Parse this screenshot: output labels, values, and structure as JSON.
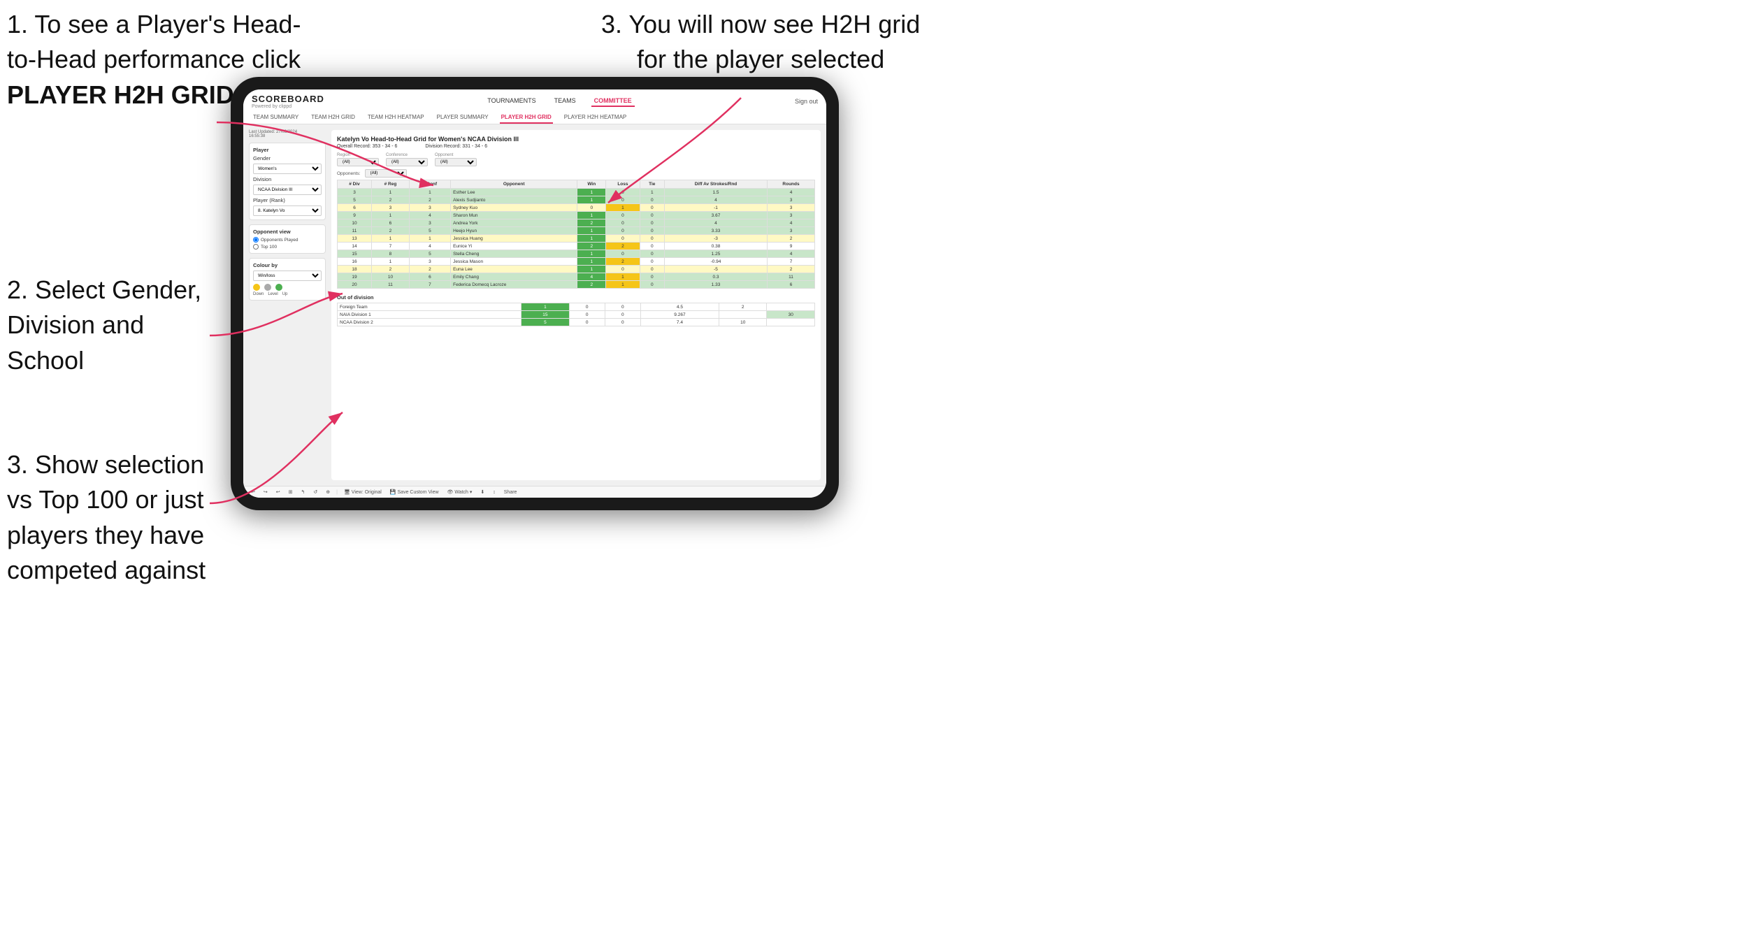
{
  "annotations": {
    "top_left_1": "1. To see a Player's Head-",
    "top_left_2": "to-Head performance click",
    "top_left_bold": "PLAYER H2H GRID",
    "top_right_1": "3. You will now see H2H grid",
    "top_right_2": "for the player selected",
    "left_mid_1": "2. Select Gender,",
    "left_mid_2": "Division and",
    "left_mid_3": "School",
    "left_bot_1": "3. Show selection",
    "left_bot_2": "vs Top 100 or just",
    "left_bot_3": "players they have",
    "left_bot_4": "competed against"
  },
  "nav": {
    "logo": "SCOREBOARD",
    "logo_sub": "Powered by clippd",
    "links": [
      "TOURNAMENTS",
      "TEAMS",
      "COMMITTEE"
    ],
    "active_link": "COMMITTEE",
    "sign_out": "Sign out",
    "sub_links": [
      "TEAM SUMMARY",
      "TEAM H2H GRID",
      "TEAM H2H HEATMAP",
      "PLAYER SUMMARY",
      "PLAYER H2H GRID",
      "PLAYER H2H HEATMAP"
    ],
    "active_sub": "PLAYER H2H GRID"
  },
  "sidebar": {
    "updated": "Last Updated: 27/03/2024",
    "updated_time": "16:55:38",
    "player_label": "Player",
    "gender_label": "Gender",
    "gender_value": "Women's",
    "division_label": "Division",
    "division_value": "NCAA Division III",
    "player_rank_label": "Player (Rank)",
    "player_rank_value": "8. Katelyn Vo",
    "opponent_view_label": "Opponent view",
    "radio1": "Opponents Played",
    "radio2": "Top 100",
    "colour_label": "Colour by",
    "colour_value": "Win/loss",
    "dot_labels": [
      "Down",
      "Level",
      "Up"
    ]
  },
  "grid": {
    "title": "Katelyn Vo Head-to-Head Grid for Women's NCAA Division III",
    "overall_record": "Overall Record: 353 - 34 - 6",
    "division_record": "Division Record: 331 - 34 - 6",
    "region_label": "Region",
    "conference_label": "Conference",
    "opponent_label": "Opponent",
    "opponents_label": "Opponents:",
    "filter_all": "(All)",
    "columns": [
      "# Div",
      "# Reg",
      "# Conf",
      "Opponent",
      "Win",
      "Loss",
      "Tie",
      "Diff Av Strokes/Rnd",
      "Rounds"
    ],
    "rows": [
      {
        "div": 3,
        "reg": 1,
        "conf": 1,
        "opponent": "Esther Lee",
        "win": 1,
        "loss": 0,
        "tie": 1,
        "diff": 1.5,
        "rounds": 4,
        "style": "win"
      },
      {
        "div": 5,
        "reg": 2,
        "conf": 2,
        "opponent": "Alexis Sudjianto",
        "win": 1,
        "loss": 0,
        "tie": 0,
        "diff": 4.0,
        "rounds": 3,
        "style": "win"
      },
      {
        "div": 6,
        "reg": 3,
        "conf": 3,
        "opponent": "Sydney Kuo",
        "win": 0,
        "loss": 1,
        "tie": 0,
        "diff": -1.0,
        "rounds": 3,
        "style": "loss"
      },
      {
        "div": 9,
        "reg": 1,
        "conf": 4,
        "opponent": "Sharon Mun",
        "win": 1,
        "loss": 0,
        "tie": 0,
        "diff": 3.67,
        "rounds": 3,
        "style": "win"
      },
      {
        "div": 10,
        "reg": 6,
        "conf": 3,
        "opponent": "Andrea York",
        "win": 2,
        "loss": 0,
        "tie": 0,
        "diff": 4.0,
        "rounds": 4,
        "style": "win"
      },
      {
        "div": 11,
        "reg": 2,
        "conf": 5,
        "opponent": "Heejo Hyun",
        "win": 1,
        "loss": 0,
        "tie": 0,
        "diff": 3.33,
        "rounds": 3,
        "style": "win"
      },
      {
        "div": 13,
        "reg": 1,
        "conf": 1,
        "opponent": "Jessica Huang",
        "win": 1,
        "loss": 0,
        "tie": 0,
        "diff": -3.0,
        "rounds": 2,
        "style": "loss"
      },
      {
        "div": 14,
        "reg": 7,
        "conf": 4,
        "opponent": "Eunice Yi",
        "win": 2,
        "loss": 2,
        "tie": 0,
        "diff": 0.38,
        "rounds": 9,
        "style": "neutral"
      },
      {
        "div": 15,
        "reg": 8,
        "conf": 5,
        "opponent": "Stella Cheng",
        "win": 1,
        "loss": 0,
        "tie": 0,
        "diff": 1.25,
        "rounds": 4,
        "style": "win"
      },
      {
        "div": 16,
        "reg": 1,
        "conf": 3,
        "opponent": "Jessica Mason",
        "win": 1,
        "loss": 2,
        "tie": 0,
        "diff": -0.94,
        "rounds": 7,
        "style": "neutral"
      },
      {
        "div": 18,
        "reg": 2,
        "conf": 2,
        "opponent": "Euna Lee",
        "win": 1,
        "loss": 0,
        "tie": 0,
        "diff": -5.0,
        "rounds": 2,
        "style": "loss"
      },
      {
        "div": 19,
        "reg": 10,
        "conf": 6,
        "opponent": "Emily Chang",
        "win": 4,
        "loss": 1,
        "tie": 0,
        "diff": 0.3,
        "rounds": 11,
        "style": "win"
      },
      {
        "div": 20,
        "reg": 11,
        "conf": 7,
        "opponent": "Federica Domecq Lacroze",
        "win": 2,
        "loss": 1,
        "tie": 0,
        "diff": 1.33,
        "rounds": 6,
        "style": "win"
      }
    ],
    "out_division_label": "Out of division",
    "out_division_rows": [
      {
        "team": "Foreign Team",
        "win": 1,
        "loss": 0,
        "tie": 0,
        "diff": 4.5,
        "rounds": 2,
        "extra": ""
      },
      {
        "team": "NAIA Division 1",
        "win": 15,
        "loss": 0,
        "tie": 0,
        "diff": 9.267,
        "rounds": "",
        "extra": 30
      },
      {
        "team": "NCAA Division 2",
        "win": 5,
        "loss": 0,
        "tie": 0,
        "diff": 7.4,
        "rounds": 10,
        "extra": ""
      }
    ]
  },
  "toolbar": {
    "buttons": [
      "↩",
      "↪",
      "↩",
      "⊞",
      "↰",
      "↺",
      "⊕",
      "View: Original",
      "Save Custom View",
      "👁 Watch",
      "⬇",
      "↕",
      "Share"
    ]
  },
  "colors": {
    "accent": "#e03060",
    "win_bg": "#c8e6c9",
    "loss_bg": "#fff9c4",
    "neutral_bg": "#ffffff",
    "dark_win": "#a5d6a7"
  }
}
